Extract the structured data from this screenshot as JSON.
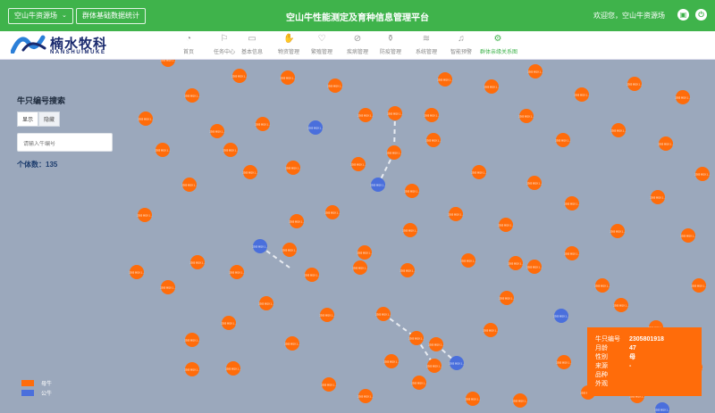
{
  "header": {
    "farm_selector": "空山牛资源场",
    "group_stats_button": "群体基础数据统计",
    "platform_title": "空山牛性能测定及育种信息管理平台",
    "welcome_text": "欢迎您，空山牛资源场"
  },
  "brand": {
    "name_cn": "楠水牧科",
    "name_en": "NANSHUIMUKE"
  },
  "nav": [
    {
      "label": "首页",
      "icon": "pie-chart-icon",
      "glyph": "◔"
    },
    {
      "label": "任务中心",
      "icon": "flag-icon",
      "glyph": "⚐"
    },
    {
      "label": "基本信息",
      "icon": "box-icon",
      "glyph": "▭"
    },
    {
      "label": "物资管理",
      "icon": "hand-icon",
      "glyph": "✋"
    },
    {
      "label": "繁殖管理",
      "icon": "heart-icon",
      "glyph": "♡"
    },
    {
      "label": "疾病管理",
      "icon": "pill-icon",
      "glyph": "⊘"
    },
    {
      "label": "防疫管理",
      "icon": "syringe-icon",
      "glyph": "⚱"
    },
    {
      "label": "系统管理",
      "icon": "layers-icon",
      "glyph": "≋"
    },
    {
      "label": "智能预警",
      "icon": "bell-icon",
      "glyph": "♫"
    },
    {
      "label": "群体亲缘关系图",
      "icon": "network-icon",
      "glyph": "⚙"
    }
  ],
  "panel": {
    "title": "牛只编号搜索",
    "tab_show": "显示",
    "tab_hide": "隐藏",
    "search_placeholder": "请输入牛编号",
    "count_text": "个体数：135"
  },
  "legend": {
    "female_label": "母牛",
    "male_label": "公牛",
    "female_color": "#ff6c0a",
    "male_color": "#4a6fdc"
  },
  "tooltip": {
    "rows": [
      {
        "key": "牛只编号",
        "value": "2305801918"
      },
      {
        "key": "月龄",
        "value": "47"
      },
      {
        "key": "性别",
        "value": "母"
      },
      {
        "key": "来源",
        "value": "-"
      },
      {
        "key": "品种",
        "value": ""
      },
      {
        "key": "外观",
        "value": ""
      }
    ]
  },
  "node_label": "2305 8019 1…"
}
